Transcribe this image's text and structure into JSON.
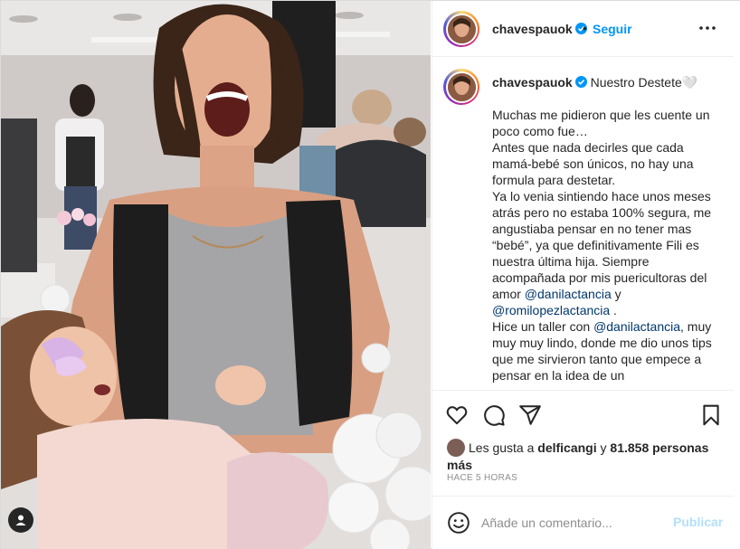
{
  "post": {
    "username": "chavespauok",
    "follow_label": "Seguir",
    "separator": "•",
    "caption_title": "Nuestro Destete🤍",
    "caption_paragraphs": [
      "Muchas me pidieron que les cuente un poco como fue…",
      "Antes que nada decirles que cada mamá-bebé son únicos, no hay una formula para destetar.",
      "Ya lo venia sintiendo hace unos meses atrás pero no estaba 100% segura, me angustiaba pensar en no tener mas “bebé”, ya que definitivamente Fili es nuestra última hija. Siempre acompañada por mis puericultoras del amor",
      "Hice un taller con",
      "muy muy muy lindo, donde me dio unos tips que me sirvieron tanto que empece a pensar en la idea de un"
    ],
    "mention_1": "@danilactancia",
    "mention_and": "y",
    "mention_2": "@romilopezlactancia",
    "mention_2_suffix": ".",
    "mention_3": "@danilactancia",
    "mention_3_suffix": ","
  },
  "likes": {
    "prefix": "Les gusta a",
    "user": "delficangi",
    "connector": "y",
    "count": "81.858 personas más"
  },
  "timestamp": "HACE 5 HORAS",
  "comment": {
    "placeholder": "Añade un comentario...",
    "publish_label": "Publicar"
  },
  "icons": {
    "more": "more-options-icon",
    "like": "heart-icon",
    "comment": "comment-icon",
    "share": "share-icon",
    "save": "bookmark-icon",
    "emoji": "emoji-icon",
    "user_tag": "user-tag-icon",
    "verified": "verified-badge-icon"
  },
  "colors": {
    "link_blue": "#0095f6",
    "mention": "#00376b",
    "muted": "#8e8e8e",
    "publish_disabled": "#b2dffc",
    "verified": "#0095f6"
  }
}
